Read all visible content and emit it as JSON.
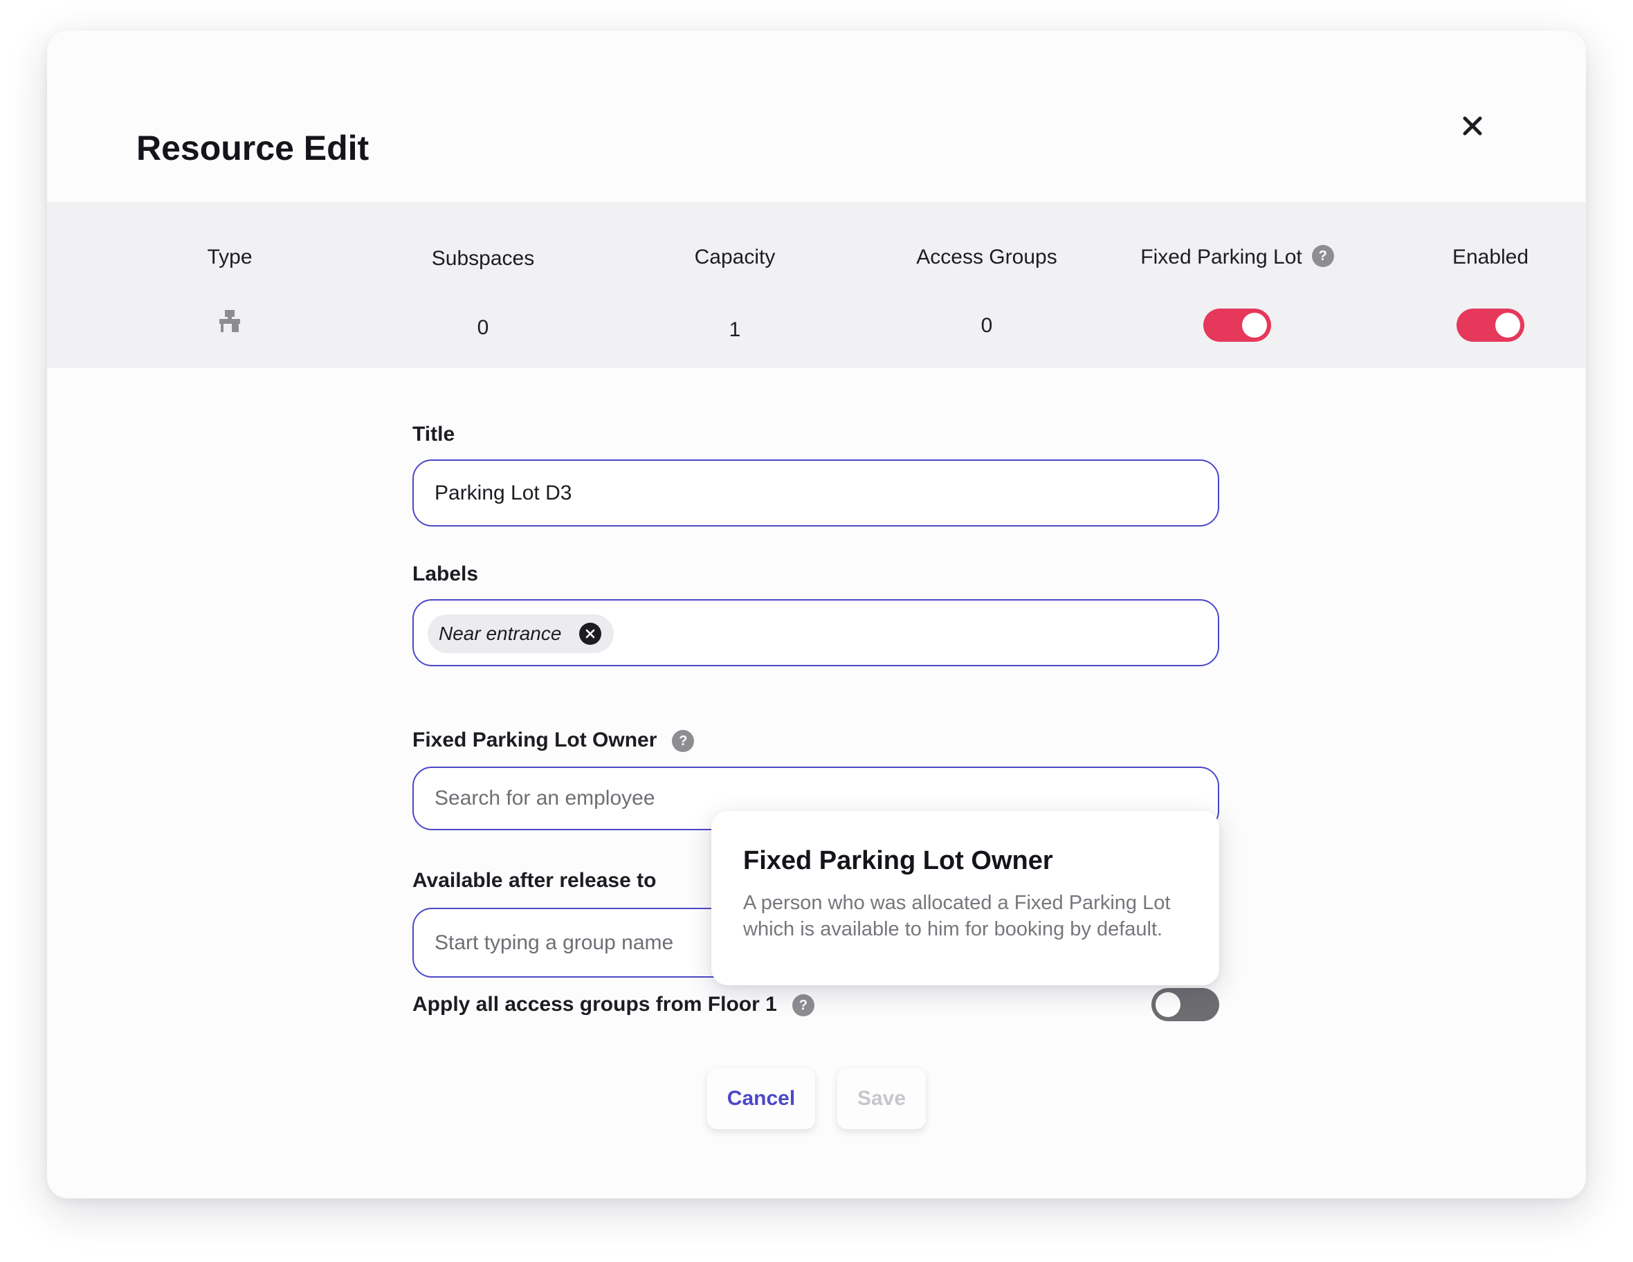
{
  "dialog": {
    "title": "Resource Edit"
  },
  "summary": {
    "columns": [
      {
        "label": "Type",
        "icon": "desk-icon"
      },
      {
        "label": "Subspaces",
        "value": "0"
      },
      {
        "label": "Capacity",
        "value": "1"
      },
      {
        "label": "Access Groups",
        "value": "0"
      },
      {
        "label": "Fixed Parking Lot",
        "toggle_on": true,
        "has_help": true
      },
      {
        "label": "Enabled",
        "toggle_on": true
      }
    ]
  },
  "form": {
    "title_label": "Title",
    "title_value": "Parking Lot D3",
    "labels_label": "Labels",
    "labels_chips": [
      "Near entrance"
    ],
    "owner_label": "Fixed Parking Lot Owner",
    "owner_placeholder": "Search for an employee",
    "release_label": "Available after release to",
    "release_placeholder": "Start typing a group name",
    "apply_label": "Apply all access groups from Floor 1",
    "apply_toggle_on": false
  },
  "tooltip": {
    "title": "Fixed Parking Lot Owner",
    "body": "A person who was allocated a Fixed Parking Lot which is available to him for booking by default."
  },
  "buttons": {
    "cancel": "Cancel",
    "save": "Save"
  },
  "colors": {
    "accent": "#4b48c8",
    "toggle_on": "#e5385a",
    "toggle_off": "#6e6d72",
    "summary_bg": "#f1f0f3"
  }
}
